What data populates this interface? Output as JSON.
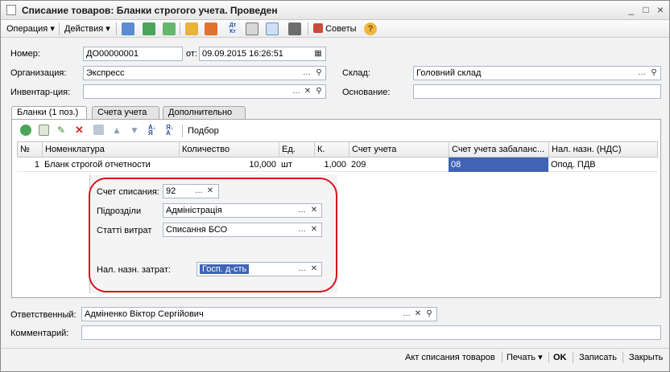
{
  "window": {
    "title": "Списание товаров: Бланки строгого учета. Проведен",
    "minimize": "_",
    "maximize": "□",
    "close": "×"
  },
  "toolbar": {
    "operation_label": "Операция",
    "actions_label": "Действия",
    "advice_label": "Советы",
    "help_label": "?",
    "dtkt_label": "Дт Кт"
  },
  "header": {
    "number_label": "Номер:",
    "number_value": "ДО00000001",
    "date_label": "от:",
    "date_value": "09.09.2015 16:26:51",
    "org_label": "Организация:",
    "org_value": "Экспресс",
    "warehouse_label": "Склад:",
    "warehouse_value": "Головний склад",
    "inventory_label": "Инвентар-ция:",
    "inventory_value": "",
    "basis_label": "Основание:",
    "basis_value": ""
  },
  "tabs": [
    {
      "label": "Бланки (1 поз.)"
    },
    {
      "label": "Счета учета"
    },
    {
      "label": "Дополнительно"
    }
  ],
  "grid_toolbar": {
    "pick_label": "Подбор"
  },
  "grid": {
    "columns": [
      "№",
      "Номенклатура",
      "Количество",
      "Ед.",
      "К.",
      "Счет учета",
      "Счет учета забаланс...",
      "Нал. назн. (НДС)"
    ],
    "rows": [
      {
        "n": "1",
        "item": "Бланк строгой отчетности",
        "qty": "10,000",
        "unit": "шт",
        "k": "1,000",
        "account": "209",
        "offbalance": "08",
        "tax": "Опод. ПДВ"
      }
    ]
  },
  "detail": {
    "writeoff_label": "Счет списания:",
    "writeoff_value": "92",
    "division_label": "Підрозділи",
    "division_value": "Адміністрація",
    "expense_label": "Статті витрат",
    "expense_value": "Списання БСО",
    "taxpurpose_label": "Нал. назн. затрат:",
    "taxpurpose_value": "Госп. д-сть"
  },
  "footer": {
    "responsible_label": "Ответственный:",
    "responsible_value": "Адміненко Віктор Сергійович",
    "comment_label": "Комментарий:",
    "comment_value": ""
  },
  "bottombar": {
    "act_label": "Акт списания товаров",
    "print_label": "Печать",
    "ok_label": "OK",
    "save_label": "Записать",
    "close_label": "Закрыть"
  },
  "colors": {
    "selection": "#3f63b6",
    "highlight_ring": "#d9121d",
    "field_border": "#a9b6c6"
  }
}
